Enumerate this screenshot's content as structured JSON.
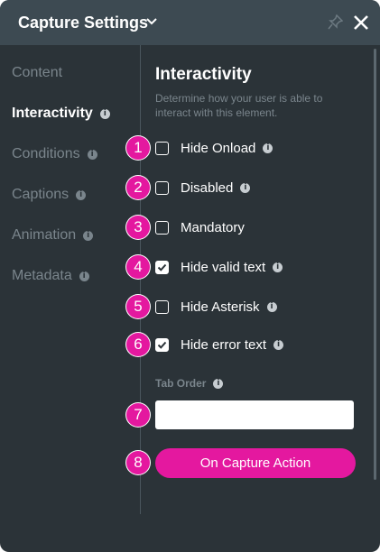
{
  "header": {
    "title": "Capture Settings"
  },
  "sidebar": {
    "items": [
      {
        "label": "Content",
        "active": false,
        "info": false
      },
      {
        "label": "Interactivity",
        "active": true,
        "info": true
      },
      {
        "label": "Conditions",
        "active": false,
        "info": true
      },
      {
        "label": "Captions",
        "active": false,
        "info": true
      },
      {
        "label": "Animation",
        "active": false,
        "info": true
      },
      {
        "label": "Metadata",
        "active": false,
        "info": true
      }
    ]
  },
  "main": {
    "title": "Interactivity",
    "description": "Determine how your user is able to interact with this element.",
    "options": [
      {
        "badge": "1",
        "label": "Hide Onload",
        "checked": false,
        "info": true
      },
      {
        "badge": "2",
        "label": "Disabled",
        "checked": false,
        "info": true
      },
      {
        "badge": "3",
        "label": "Mandatory",
        "checked": false,
        "info": false
      },
      {
        "badge": "4",
        "label": "Hide valid text",
        "checked": true,
        "info": true
      },
      {
        "badge": "5",
        "label": "Hide Asterisk",
        "checked": false,
        "info": true
      },
      {
        "badge": "6",
        "label": "Hide error text",
        "checked": true,
        "info": true
      }
    ],
    "tab_order": {
      "badge": "7",
      "label": "Tab Order",
      "value": ""
    },
    "action": {
      "badge": "8",
      "label": "On Capture Action"
    }
  },
  "colors": {
    "accent": "#e4189f",
    "panel": "#2b3338",
    "header": "#3d4a52"
  },
  "info_glyph": "i"
}
